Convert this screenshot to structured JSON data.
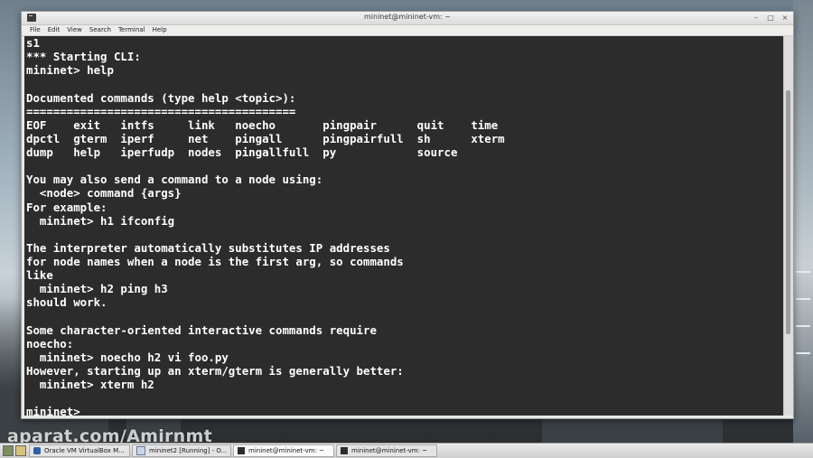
{
  "window": {
    "title": "mininet@mininet-vm: ~",
    "controls": [
      "–",
      "□",
      "×"
    ]
  },
  "menu": [
    "File",
    "Edit",
    "View",
    "Search",
    "Terminal",
    "Help"
  ],
  "terminal": {
    "lines": [
      "s1",
      "*** Starting CLI:",
      "mininet> help",
      "",
      "Documented commands (type help <topic>):",
      "========================================",
      "EOF    exit   intfs     link   noecho       pingpair      quit    time",
      "dpctl  gterm  iperf     net    pingall      pingpairfull  sh      xterm",
      "dump   help   iperfudp  nodes  pingallfull  py            source",
      "",
      "You may also send a command to a node using:",
      "  <node> command {args}",
      "For example:",
      "  mininet> h1 ifconfig",
      "",
      "The interpreter automatically substitutes IP addresses",
      "for node names when a node is the first arg, so commands",
      "like",
      "  mininet> h2 ping h3",
      "should work.",
      "",
      "Some character-oriented interactive commands require",
      "noecho:",
      "  mininet> noecho h2 vi foo.py",
      "However, starting up an xterm/gterm is generally better:",
      "  mininet> xterm h2",
      "",
      "mininet> "
    ]
  },
  "watermark": "aparat.com/Amirnmt",
  "taskbar": {
    "tasks": [
      {
        "label": "Oracle VM VirtualBox M...",
        "icon": "virtualbox-icon"
      },
      {
        "label": "mininet2 [Running] - O...",
        "icon": "virtualbox-vm-icon"
      },
      {
        "label": "mininet@mininet-vm: ~",
        "icon": "terminal-icon"
      },
      {
        "label": "mininet@mininet-vm: ~",
        "icon": "terminal-icon"
      }
    ]
  },
  "colors": {
    "terminal_bg": "#2c2c2c",
    "terminal_fg": "#ffffff"
  }
}
